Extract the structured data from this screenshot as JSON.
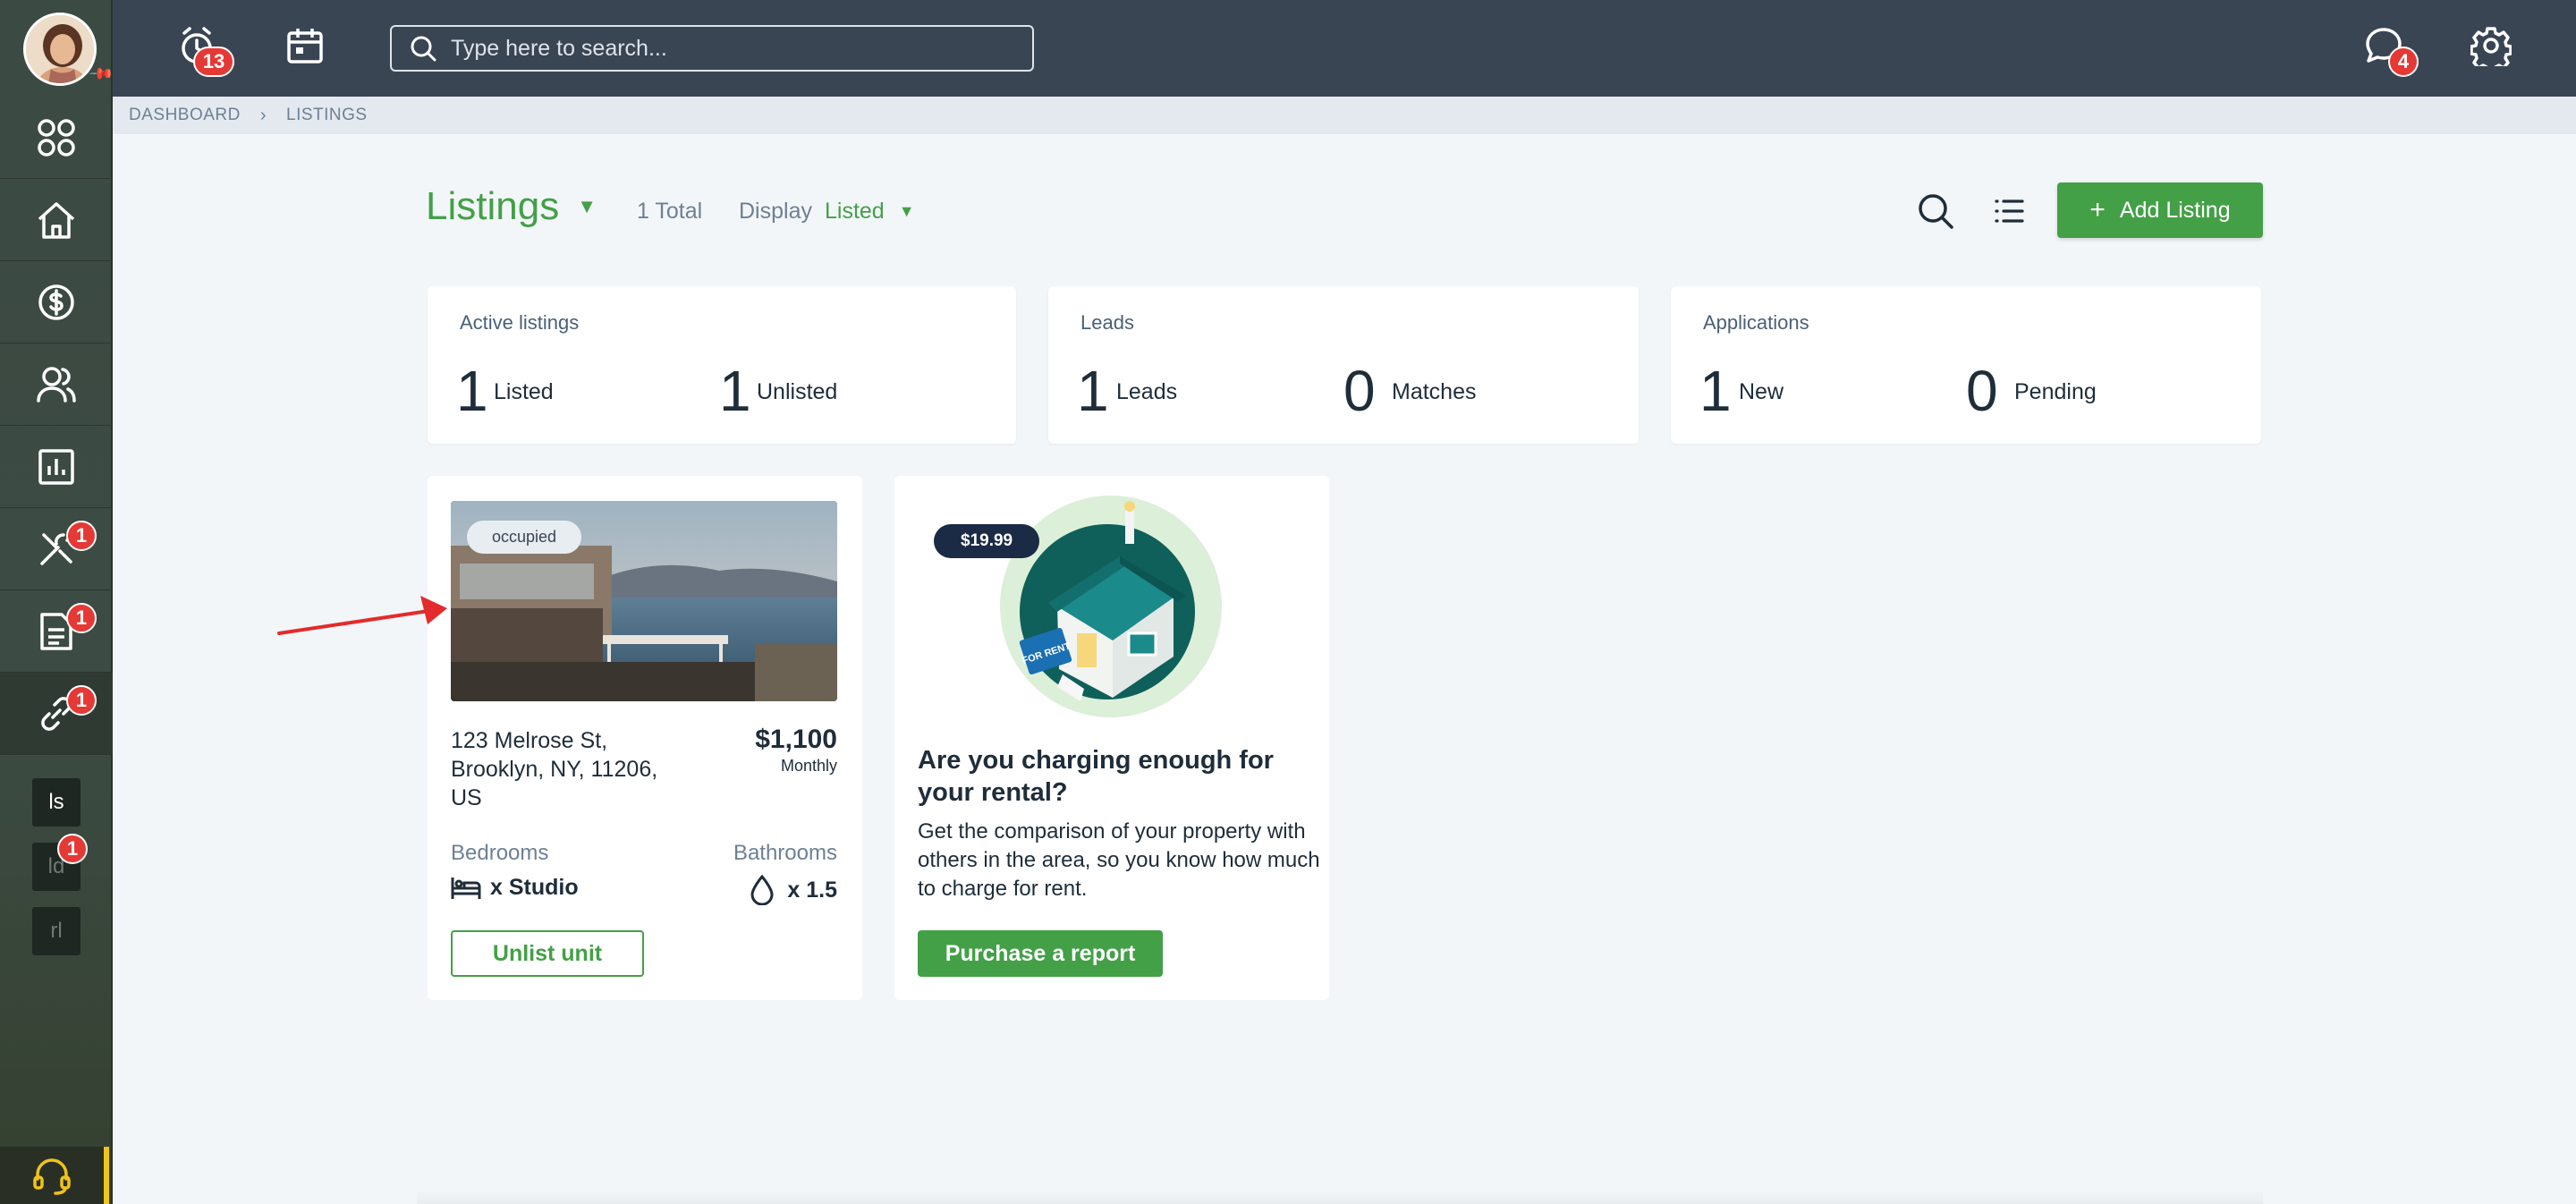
{
  "topbar": {
    "alarm_count": "13",
    "messages_count": "4",
    "search_placeholder": "Type here to search..."
  },
  "sidebar": {
    "badges": {
      "maintenance": "1",
      "documents": "1",
      "links": "1",
      "sub_ld": "1"
    },
    "sub_items": [
      "ls",
      "ld",
      "rl"
    ]
  },
  "breadcrumb": {
    "items": [
      "DASHBOARD",
      "LISTINGS"
    ]
  },
  "header": {
    "title": "Listings",
    "total": "1 Total",
    "display_label": "Display",
    "display_value": "Listed",
    "add_button": "Add Listing"
  },
  "stats": [
    {
      "label": "Active listings",
      "items": [
        {
          "value": "1",
          "label": "Listed"
        },
        {
          "value": "1",
          "label": "Unlisted"
        }
      ]
    },
    {
      "label": "Leads",
      "items": [
        {
          "value": "1",
          "label": "Leads"
        },
        {
          "value": "0",
          "label": "Matches"
        }
      ]
    },
    {
      "label": "Applications",
      "items": [
        {
          "value": "1",
          "label": "New"
        },
        {
          "value": "0",
          "label": "Pending"
        }
      ]
    }
  ],
  "listing": {
    "status_tag": "occupied",
    "address": "123 Melrose St, Brooklyn, NY, 11206, US",
    "price": "$1,100",
    "period": "Monthly",
    "bedrooms_label": "Bedrooms",
    "bedrooms_value": "x Studio",
    "bathrooms_label": "Bathrooms",
    "bathrooms_value": "x 1.5",
    "unlist_button": "Unlist unit"
  },
  "report": {
    "price": "$19.99",
    "title": "Are you charging enough for your rental?",
    "text": "Get the comparison of your property with others in the area, so you know how much to charge for rent.",
    "button": "Purchase a report",
    "sign_text": "FOR RENT"
  },
  "colors": {
    "accent": "#43a047",
    "topbar": "#3a4554",
    "badge": "#e53935",
    "annotation_arrow": "#e32b2b"
  }
}
